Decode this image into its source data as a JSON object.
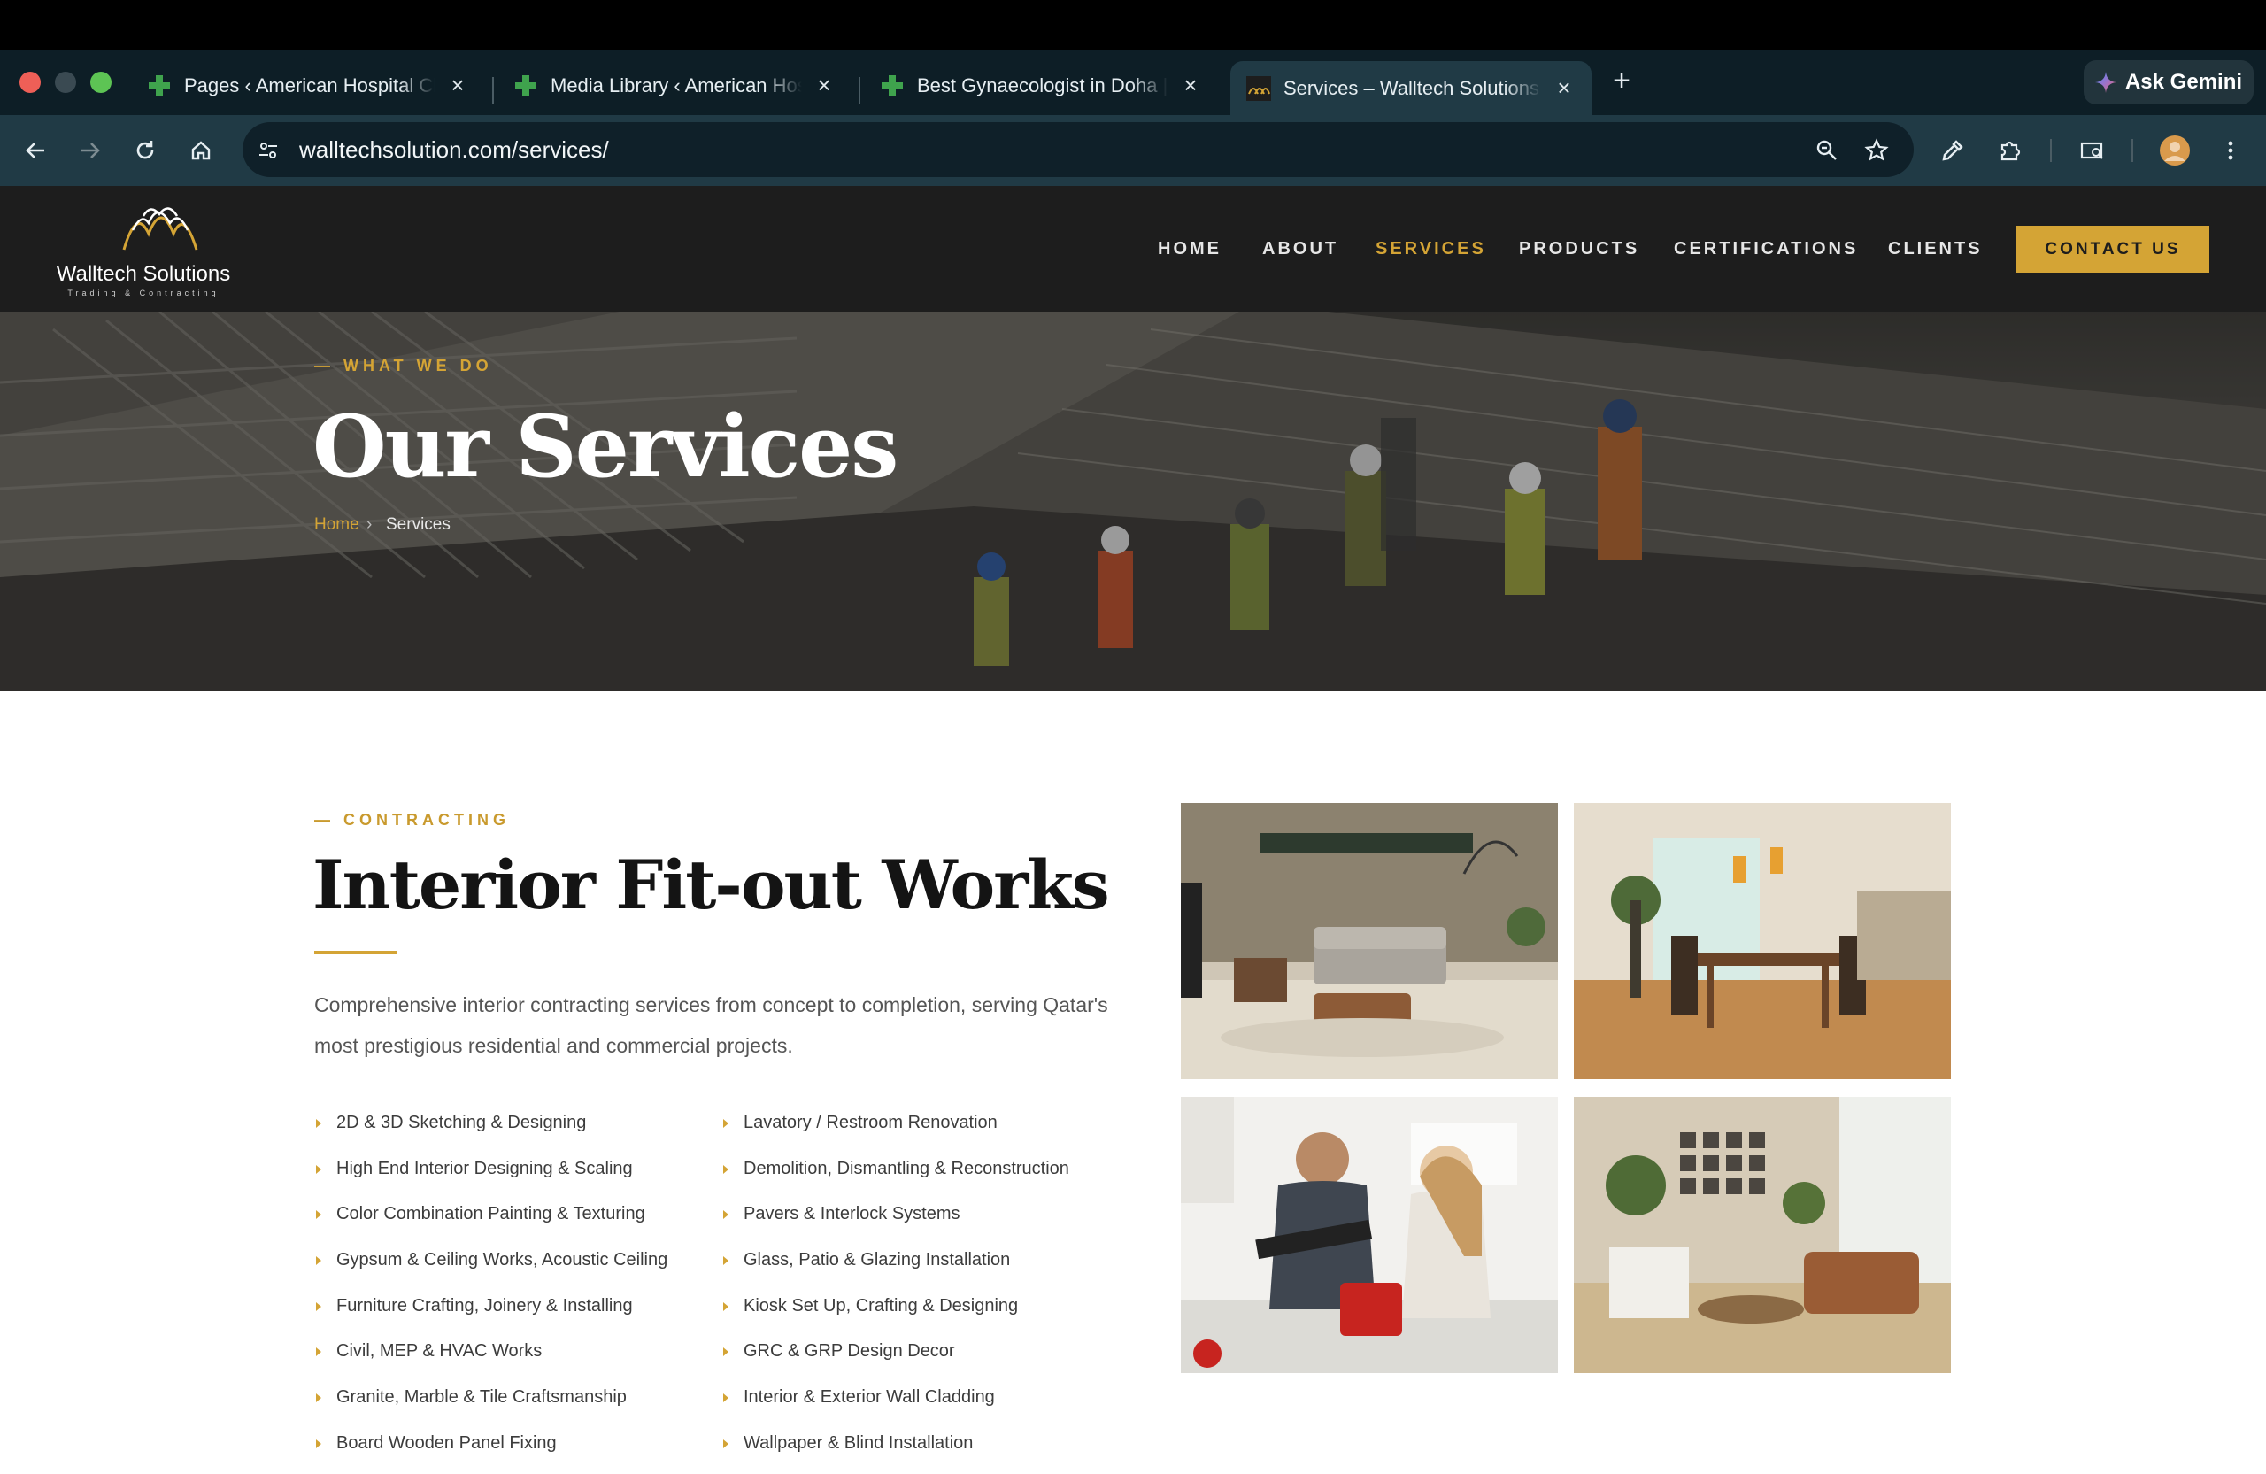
{
  "browser": {
    "tabs": [
      {
        "title": "Pages ‹ American Hospital Cli",
        "active": false
      },
      {
        "title": "Media Library ‹ American Hos",
        "active": false
      },
      {
        "title": "Best Gynaecologist in Doha |",
        "active": false
      },
      {
        "title": "Services – Walltech Solutions",
        "active": true
      }
    ],
    "new_tab": "+",
    "gemini_label": "Ask Gemini",
    "url": "walltechsolution.com/services/",
    "icons": [
      "back-icon",
      "forward-icon",
      "reload-icon",
      "home-icon",
      "site-info-icon",
      "zoom-icon",
      "star-icon",
      "eyedropper-icon",
      "extensions-icon",
      "tab-search-icon",
      "profile-avatar",
      "menu-icon"
    ]
  },
  "site": {
    "logo_text": "Walltech Solutions",
    "logo_sub": "Trading & Contracting",
    "menu": [
      "HOME",
      "ABOUT",
      "SERVICES",
      "PRODUCTS",
      "CERTIFICATIONS",
      "CLIENTS"
    ],
    "active_menu": "SERVICES",
    "contact": "CONTACT US",
    "accent": "#d4a435"
  },
  "hero": {
    "kicker": "— WHAT WE DO",
    "title": "Our Services",
    "breadcrumb_home": "Home",
    "breadcrumb_sep": "›",
    "breadcrumb_current": "Services"
  },
  "section": {
    "kicker": "— CONTRACTING",
    "title": "Interior Fit-out Works",
    "description": "Comprehensive interior contracting services from concept to completion, serving Qatar's most prestigious residential and commercial projects.",
    "left_items": [
      "2D & 3D Sketching & Designing",
      "High End Interior Designing & Scaling",
      "Color Combination Painting & Texturing",
      "Gypsum & Ceiling Works, Acoustic Ceiling",
      "Furniture Crafting, Joinery & Installing",
      "Civil, MEP & HVAC Works",
      "Granite, Marble & Tile Craftsmanship",
      "Board Wooden Panel Fixing"
    ],
    "right_items": [
      "Lavatory / Restroom Renovation",
      "Demolition, Dismantling & Reconstruction",
      "Pavers & Interlock Systems",
      "Glass, Patio & Glazing Installation",
      "Kiosk Set Up, Crafting & Designing",
      "GRC & GRP Design Decor",
      "Interior & Exterior Wall Cladding",
      "Wallpaper & Blind Installation"
    ],
    "photos": [
      "living-room-photo",
      "dining-room-photo",
      "kitchen-couple-photo",
      "lounge-photo"
    ]
  }
}
